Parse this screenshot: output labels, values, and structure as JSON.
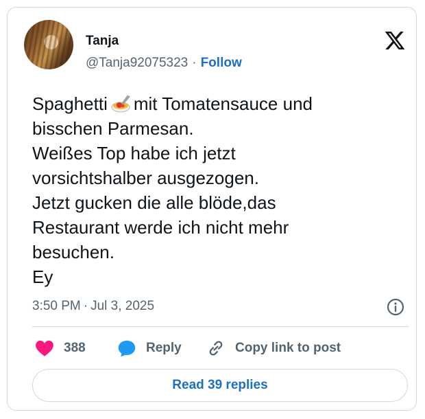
{
  "author": {
    "name": "Tanja",
    "handle": "@Tanja92075323",
    "separator": "·",
    "follow_label": "Follow"
  },
  "tweet": {
    "lines": [
      {
        "before": "Spaghetti",
        "emoji": "spaghetti-icon",
        "after": "mit Tomatensauce und"
      },
      {
        "text": "bisschen Parmesan."
      },
      {
        "text": "Weißes Top habe ich jetzt"
      },
      {
        "text": "vorsichtshalber ausgezogen."
      },
      {
        "text": "Jetzt gucken die alle blöde,das"
      },
      {
        "text": "Restaurant werde ich nicht mehr"
      },
      {
        "text": "besuchen."
      },
      {
        "text": "Ey"
      }
    ]
  },
  "meta": {
    "time": "3:50 PM",
    "separator": "·",
    "date": "Jul 3, 2025"
  },
  "actions": {
    "like_count": "388",
    "reply_label": "Reply",
    "copy_label": "Copy link to post"
  },
  "footer": {
    "read_replies_label": "Read 39 replies"
  },
  "colors": {
    "accent": "#1d6fc4",
    "like": "#f91880",
    "reply_icon": "#1d9bf0",
    "muted": "#536471",
    "text": "#0f1419",
    "border": "#cfd9de"
  }
}
